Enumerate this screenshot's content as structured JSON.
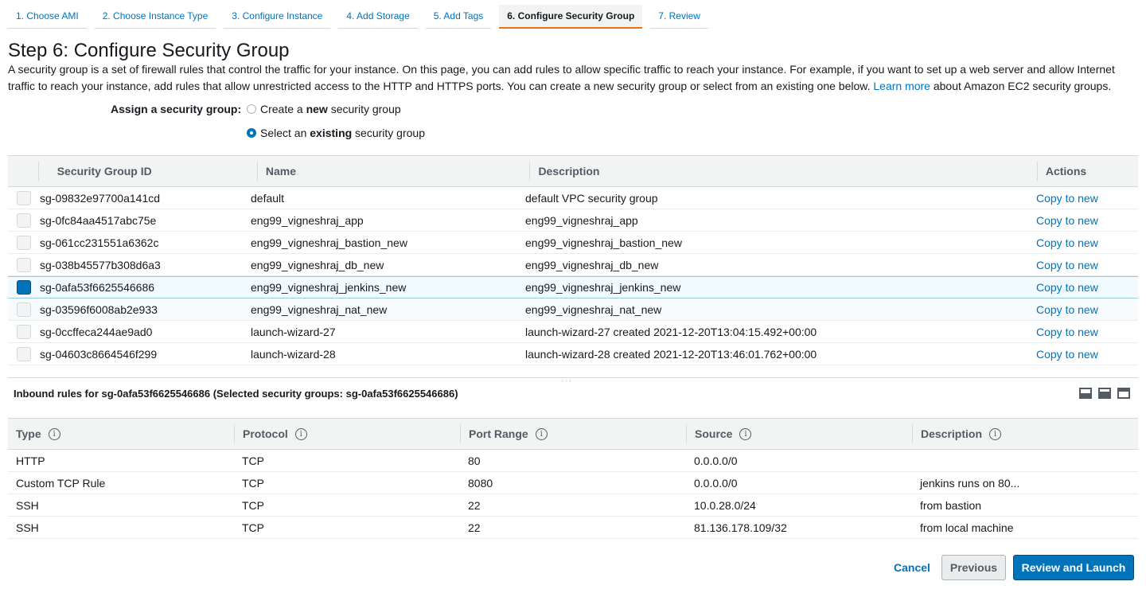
{
  "tabs": [
    {
      "label": "1. Choose AMI"
    },
    {
      "label": "2. Choose Instance Type"
    },
    {
      "label": "3. Configure Instance"
    },
    {
      "label": "4. Add Storage"
    },
    {
      "label": "5. Add Tags"
    },
    {
      "label": "6. Configure Security Group"
    },
    {
      "label": "7. Review"
    }
  ],
  "active_tab": "6. Configure Security Group",
  "page": {
    "title": "Step 6: Configure Security Group",
    "intro_text": "A security group is a set of firewall rules that control the traffic for your instance. On this page, you can add rules to allow specific traffic to reach your instance. For example, if you want to set up a web server and allow Internet traffic to reach your instance, add rules that allow unrestricted access to the HTTP and HTTPS ports. You can create a new security group or select from an existing one below.",
    "learn_more": "Learn more",
    "intro_suffix": "about Amazon EC2 security groups."
  },
  "assign": {
    "label": "Assign a security group:",
    "option_new_pre": "Create a ",
    "option_new_bold": "new",
    "option_new_post": " security group",
    "option_existing_pre": "Select an ",
    "option_existing_bold": "existing",
    "option_existing_post": " security group",
    "selected": "existing"
  },
  "sg_table": {
    "headers": {
      "id": "Security Group ID",
      "name": "Name",
      "description": "Description",
      "actions": "Actions"
    },
    "rows": [
      {
        "id": "sg-09832e97700a141cd",
        "name": "default",
        "description": "default VPC security group",
        "action": "Copy to new",
        "checked": false
      },
      {
        "id": "sg-0fc84aa4517abc75e",
        "name": "eng99_vigneshraj_app",
        "description": "eng99_vigneshraj_app",
        "action": "Copy to new",
        "checked": false
      },
      {
        "id": "sg-061cc231551a6362c",
        "name": "eng99_vigneshraj_bastion_new",
        "description": "eng99_vigneshraj_bastion_new",
        "action": "Copy to new",
        "checked": false
      },
      {
        "id": "sg-038b45577b308d6a3",
        "name": "eng99_vigneshraj_db_new",
        "description": "eng99_vigneshraj_db_new",
        "action": "Copy to new",
        "checked": false
      },
      {
        "id": "sg-0afa53f6625546686",
        "name": "eng99_vigneshraj_jenkins_new",
        "description": "eng99_vigneshraj_jenkins_new",
        "action": "Copy to new",
        "checked": true
      },
      {
        "id": "sg-03596f6008ab2e933",
        "name": "eng99_vigneshraj_nat_new",
        "description": "eng99_vigneshraj_nat_new",
        "action": "Copy to new",
        "checked": false
      },
      {
        "id": "sg-0ccffeca244ae9ad0",
        "name": "launch-wizard-27",
        "description": "launch-wizard-27 created 2021-12-20T13:04:15.492+00:00",
        "action": "Copy to new",
        "checked": false
      },
      {
        "id": "sg-04603c8664546f299",
        "name": "launch-wizard-28",
        "description": "launch-wizard-28 created 2021-12-20T13:46:01.762+00:00",
        "action": "Copy to new",
        "checked": false
      }
    ]
  },
  "inbound": {
    "title": "Inbound rules for sg-0afa53f6625546686 (Selected security groups: sg-0afa53f6625546686)",
    "headers": {
      "type": "Type",
      "protocol": "Protocol",
      "port_range": "Port Range",
      "source": "Source",
      "description": "Description"
    },
    "rows": [
      {
        "type": "HTTP",
        "protocol": "TCP",
        "port_range": "80",
        "source": "0.0.0.0/0",
        "description": ""
      },
      {
        "type": "Custom TCP Rule",
        "protocol": "TCP",
        "port_range": "8080",
        "source": "0.0.0.0/0",
        "description": "jenkins runs on 80..."
      },
      {
        "type": "SSH",
        "protocol": "TCP",
        "port_range": "22",
        "source": "10.0.28.0/24",
        "description": "from bastion"
      },
      {
        "type": "SSH",
        "protocol": "TCP",
        "port_range": "22",
        "source": "81.136.178.109/32",
        "description": "from local machine"
      }
    ]
  },
  "footer": {
    "cancel": "Cancel",
    "previous": "Previous",
    "review_launch": "Review and Launch"
  },
  "colors": {
    "link": "#0073bb",
    "active_tab_underline": "#ec7211",
    "primary_button": "#0073bb"
  }
}
